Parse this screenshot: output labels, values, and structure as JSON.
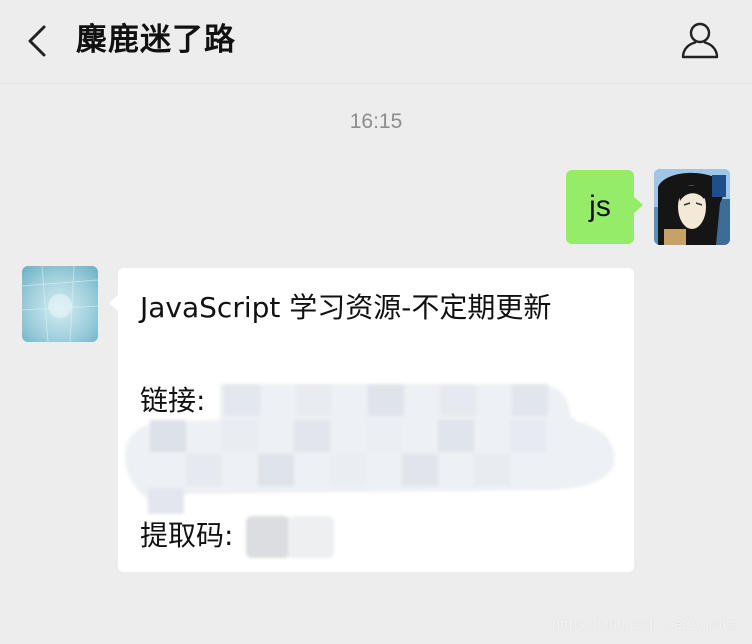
{
  "header": {
    "title": "麋鹿迷了路",
    "back_icon": "chevron-left-icon",
    "profile_icon": "person-outline-icon"
  },
  "chat": {
    "timestamp": "16:15",
    "messages": [
      {
        "direction": "outgoing",
        "text": "js",
        "bubble_color": "#95ec69"
      },
      {
        "direction": "incoming",
        "bubble_color": "#ffffff",
        "lines": [
          "JavaScript 学习资源-不定期更新",
          "链接:",
          "提取码:"
        ],
        "redacted": true
      }
    ]
  },
  "watermark": "https://blog.csdn.net/Auroka",
  "colors": {
    "background": "#ededed",
    "outgoing_bubble": "#95ec69",
    "incoming_bubble": "#ffffff",
    "timestamp_text": "#8d8d8d"
  }
}
